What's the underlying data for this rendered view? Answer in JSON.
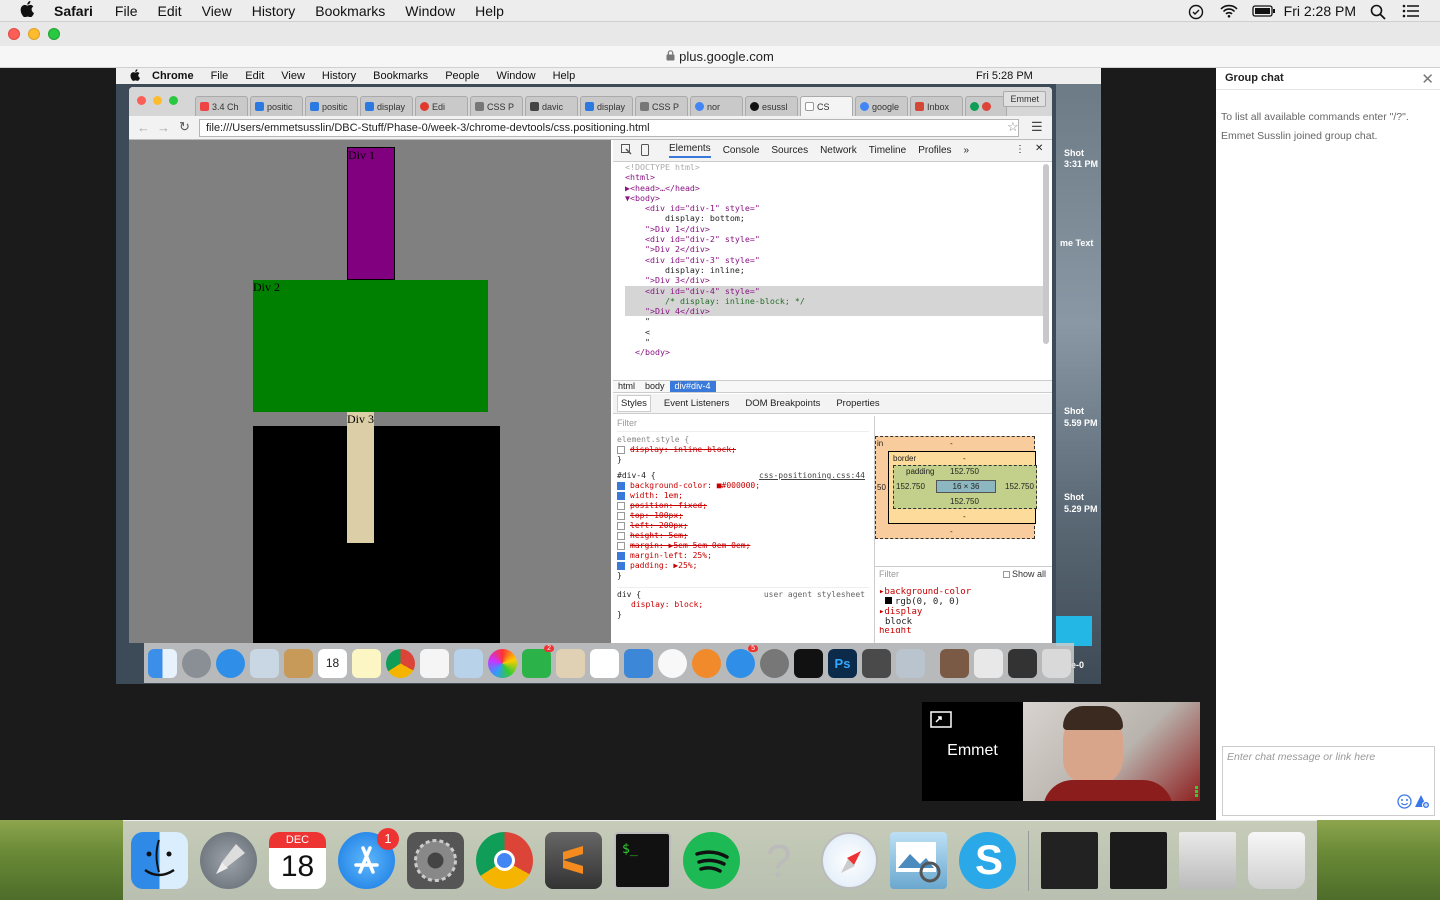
{
  "os_menubar": {
    "app": "Safari",
    "items": [
      "File",
      "Edit",
      "View",
      "History",
      "Bookmarks",
      "Window",
      "Help"
    ],
    "clock": "Fri 2:28 PM"
  },
  "safari": {
    "url": "plus.google.com"
  },
  "shared_screen": {
    "menubar": {
      "app": "Chrome",
      "items": [
        "File",
        "Edit",
        "View",
        "History",
        "Bookmarks",
        "People",
        "Window",
        "Help"
      ],
      "clock": "Fri 5:28 PM"
    },
    "desktop_labels": [
      "Shot",
      "3:31 PM",
      "me Text",
      "Shot",
      "5.59 PM",
      "Shot",
      "5.29 PM",
      "e-0"
    ],
    "chrome": {
      "tabs": [
        "3.4 Ch",
        "positic",
        "positic",
        "display",
        "Edi",
        "CSS P",
        "davic",
        "display",
        "CSS P",
        "nor",
        "esussl",
        "CS",
        "google",
        "Inbox",
        ""
      ],
      "user_button": "Emmet",
      "omnibox": "file:///Users/emmetsusslin/DBC-Stuff/Phase-0/week-3/chrome-devtools/css.positioning.html"
    },
    "page": {
      "div1": "Div 1",
      "div2": "Div 2",
      "div3": "Div 3"
    },
    "devtools": {
      "tabs": [
        "Elements",
        "Console",
        "Sources",
        "Network",
        "Timeline",
        "Profiles",
        "»"
      ],
      "elements_lines": [
        "<!DOCTYPE html>",
        "<html>",
        "▶<head>…</head>",
        "▼<body>",
        "    <div id=\"div-1\" style=\"",
        "        display: bottom;",
        "    \">Div 1</div>",
        "    <div id=\"div-2\" style=\"",
        "    \">Div 2</div>",
        "    <div id=\"div-3\" style=\"",
        "        display: inline;",
        "    \">Div 3</div>",
        "    <div id=\"div-4\" style=\"",
        "        /* display: inline-block; */",
        "    \">Div 4</div>",
        "    \"",
        "",
        "    <",
        "",
        "    \"",
        "  </body>"
      ],
      "breadcrumbs": [
        "html",
        "body",
        "div#div-4"
      ],
      "subtabs": [
        "Styles",
        "Event Listeners",
        "DOM Breakpoints",
        "Properties"
      ],
      "styles_filter": "Filter",
      "element_style": {
        "selector": "element.style {",
        "rule": "display: inline-block;"
      },
      "div4_rule": {
        "selector": "#div-4 {",
        "source": "css-positioning.css:44",
        "props": [
          {
            "text": "background-color: ■#000000;",
            "on": true,
            "struck": false
          },
          {
            "text": "width: 1em;",
            "on": true,
            "struck": false
          },
          {
            "text": "position: fixed;",
            "on": false,
            "struck": true
          },
          {
            "text": "top: 100px;",
            "on": false,
            "struck": true
          },
          {
            "text": "left: 200px;",
            "on": false,
            "struck": true
          },
          {
            "text": "height: 5em;",
            "on": false,
            "struck": true
          },
          {
            "text": "margin: ▶5em 5em 0em 0em;",
            "on": false,
            "struck": true
          },
          {
            "text": "margin-left: 25%;",
            "on": true,
            "struck": false
          },
          {
            "text": "padding: ▶25%;",
            "on": true,
            "struck": false
          }
        ]
      },
      "ua_rule": {
        "selector": "div {",
        "source": "user agent stylesheet",
        "prop": "display: block;"
      },
      "boxmodel": {
        "border": "border",
        "border_val": "-",
        "padding": "padding",
        "padding_top": "152.750",
        "padding_left": "152.750",
        "padding_right": "152.750",
        "padding_bottom": "152.750",
        "content": "16 × 36",
        "margin_dash": "-",
        "margin_left": "50",
        "margin_prefix": "in"
      },
      "computed": {
        "filter": "Filter",
        "show_all": "Show all",
        "items": [
          {
            "name": "background-color",
            "value": "rgb(0, 0, 0)"
          },
          {
            "name": "display",
            "value": "block"
          }
        ],
        "cut": "height"
      }
    }
  },
  "chat": {
    "title": "Group chat",
    "messages": [
      "To list all available commands enter \"/?\".",
      "Emmet Susslin joined group chat."
    ],
    "input_placeholder": "Enter chat message or link here"
  },
  "video": {
    "name": "Emmet"
  },
  "dock": {
    "calendar_month": "DEC",
    "calendar_day": "18",
    "appstore_badge": "1",
    "inner_calendar_day": "18",
    "inner_badge_1": "2",
    "inner_badge_2": "5"
  }
}
